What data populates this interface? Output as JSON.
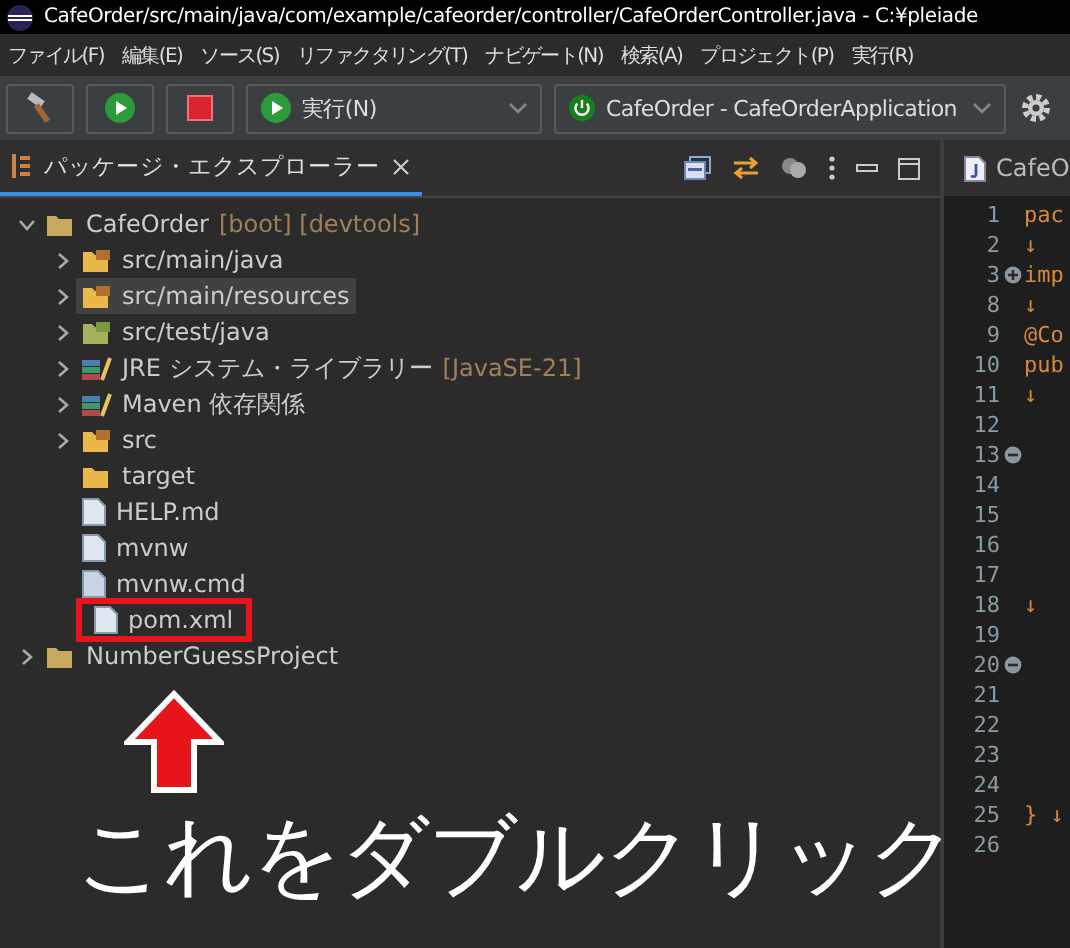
{
  "window": {
    "title": "CafeOrder/src/main/java/com/example/cafeorder/controller/CafeOrderController.java - C:¥pleiade"
  },
  "menu": [
    "ファイル(F)",
    "編集(E)",
    "ソース(S)",
    "リファクタリング(T)",
    "ナビゲート(N)",
    "検索(A)",
    "プロジェクト(P)",
    "実行(R)"
  ],
  "toolbar": {
    "run_menu": "実行(N)",
    "launch_config": "CafeOrder - CafeOrderApplication"
  },
  "explorer": {
    "title": "パッケージ・エクスプローラー",
    "tree": [
      {
        "name": "CafeOrder",
        "decoration": "[boot] [devtools]",
        "kind": "project",
        "expanded": true,
        "selected": false,
        "highlighted": false,
        "children": [
          {
            "name": "src/main/java",
            "kind": "source",
            "expanded": false,
            "selected": false,
            "highlighted": false
          },
          {
            "name": "src/main/resources",
            "kind": "source",
            "expanded": false,
            "selected": true,
            "highlighted": false
          },
          {
            "name": "src/test/java",
            "kind": "testsource",
            "expanded": false,
            "selected": false,
            "highlighted": false
          },
          {
            "name": "JRE システム・ライブラリー",
            "decoration": "[JavaSE-21]",
            "kind": "library",
            "expanded": false,
            "selected": false,
            "highlighted": false
          },
          {
            "name": "Maven 依存関係",
            "kind": "library",
            "expanded": false,
            "selected": false,
            "highlighted": false
          },
          {
            "name": "src",
            "kind": "source",
            "expanded": false,
            "selected": false,
            "highlighted": false
          },
          {
            "name": "target",
            "kind": "folder",
            "selected": false,
            "highlighted": false
          },
          {
            "name": "HELP.md",
            "kind": "doc",
            "selected": false,
            "highlighted": false
          },
          {
            "name": "mvnw",
            "kind": "binary",
            "selected": false,
            "highlighted": false
          },
          {
            "name": "mvnw.cmd",
            "kind": "file",
            "selected": false,
            "highlighted": false
          },
          {
            "name": "pom.xml",
            "kind": "maven",
            "selected": false,
            "highlighted": true
          }
        ]
      },
      {
        "name": "NumberGuessProject",
        "kind": "project",
        "expanded": false,
        "selected": false,
        "highlighted": false
      }
    ]
  },
  "editor": {
    "tab": "CafeO",
    "lines": [
      {
        "number": "1",
        "code": "pac"
      },
      {
        "number": "2",
        "code": "↓"
      },
      {
        "number": "3",
        "code": "imp",
        "collapsed": true
      },
      {
        "number": "8",
        "code": "↓"
      },
      {
        "number": "9",
        "code": "@Co"
      },
      {
        "number": "10",
        "code": "pub"
      },
      {
        "number": "11",
        "code": "↓"
      },
      {
        "number": "12"
      },
      {
        "number": "13",
        "collapsed": false
      },
      {
        "number": "14"
      },
      {
        "number": "15"
      },
      {
        "number": "16"
      },
      {
        "number": "17"
      },
      {
        "number": "18",
        "code": "↓"
      },
      {
        "number": "19"
      },
      {
        "number": "20",
        "collapsed": false
      },
      {
        "number": "21"
      },
      {
        "number": "22"
      },
      {
        "number": "23"
      },
      {
        "number": "24"
      },
      {
        "number": "25",
        "code": "} ↓"
      },
      {
        "number": "26"
      }
    ]
  },
  "annotation": {
    "caption": "これをダブルクリック"
  }
}
